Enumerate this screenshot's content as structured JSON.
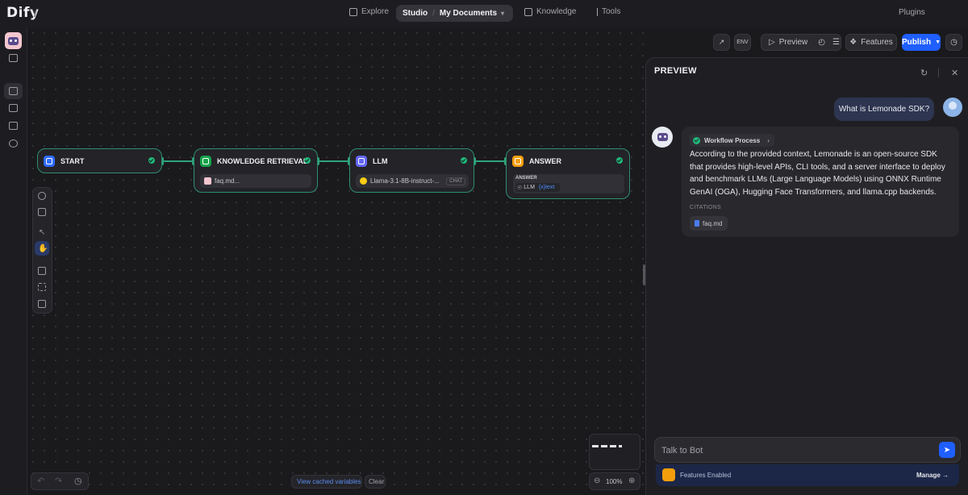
{
  "brand": {
    "logo": "Dify"
  },
  "nav": {
    "explore": "Explore",
    "studio": "Studio",
    "app_name": "My Documents",
    "knowledge": "Knowledge",
    "tools": "Tools",
    "plugins": "Plugins"
  },
  "toolbar": {
    "preview": "Preview",
    "features": "Features",
    "publish": "Publish"
  },
  "nodes": {
    "start": {
      "title": "START"
    },
    "knowledge": {
      "title": "KNOWLEDGE RETRIEVAL",
      "dataset": "faq.md..."
    },
    "llm": {
      "title": "LLM",
      "model": "Llama-3.1-8B-instruct-...",
      "mode": "CHAT"
    },
    "answer": {
      "title": "ANSWER",
      "label": "ANSWER",
      "var_node": "LLM",
      "var_name": "{x}text"
    }
  },
  "canvas": {
    "view_cached": "View cached variables",
    "clear": "Clear",
    "zoom": "100%"
  },
  "preview": {
    "title": "PREVIEW",
    "user_message": "What is Lemonade SDK?",
    "workflow_label": "Workflow Process",
    "answer": "According to the provided context, Lemonade is an open-source SDK that provides high-level APIs, CLI tools, and a server interface to deploy and benchmark LLMs (Large Language Models) using ONNX Runtime GenAI (OGA), Hugging Face Transformers, and llama.cpp backends.",
    "citations_label": "CITATIONS",
    "citation_file": "faq.md",
    "input_placeholder": "Talk to Bot",
    "features_enabled": "Features Enabled",
    "manage": "Manage →"
  },
  "colors": {
    "accent": "#1f5fff",
    "edge": "#2ea37c",
    "success": "#1fb77a",
    "start_icon": "#2f6bff",
    "knowledge_icon": "#16a34a",
    "llm_icon": "#6366f1",
    "answer_icon": "#f59e0b"
  }
}
